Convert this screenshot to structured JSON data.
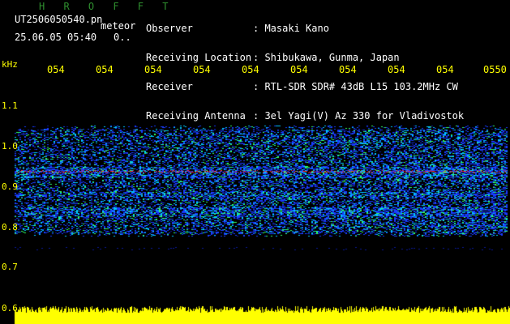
{
  "header": {
    "app_title": "H R O F F T",
    "file_name": "UT2506050540.pn",
    "mode": "meteor",
    "date_time": "25.06.05 05:40",
    "date_extra": "0..",
    "fields": [
      {
        "label": "Observer",
        "value": ": Masaki Kano"
      },
      {
        "label": "Receiving Location",
        "value": ": Shibukawa, Gunma, Japan"
      },
      {
        "label": "Receiver",
        "value": ": RTL-SDR SDR# 43dB L15 103.2MHz CW"
      },
      {
        "label": "Receiving Antenna",
        "value": ": 3el Yagi(V) Az 330 for Vladivostok"
      }
    ]
  },
  "axes": {
    "y_unit": "kHz",
    "y_ticks": [
      "1.1",
      "1.0",
      "0.9",
      "0.8",
      "0.7",
      "0.6"
    ],
    "x_ticks": [
      "054",
      "054",
      "054",
      "054",
      "054",
      "054",
      "054",
      "054",
      "054",
      "0550"
    ]
  },
  "colors": {
    "background": "#000000",
    "axis_text": "#ffff00",
    "title_green": "#2f8f2f",
    "signal_red": "#ff3030",
    "noise_blue": "#1a3cff",
    "noise_cyan": "#00c8ff",
    "noise_green": "#30ff60",
    "baseline_yellow": "#ffff00"
  }
}
